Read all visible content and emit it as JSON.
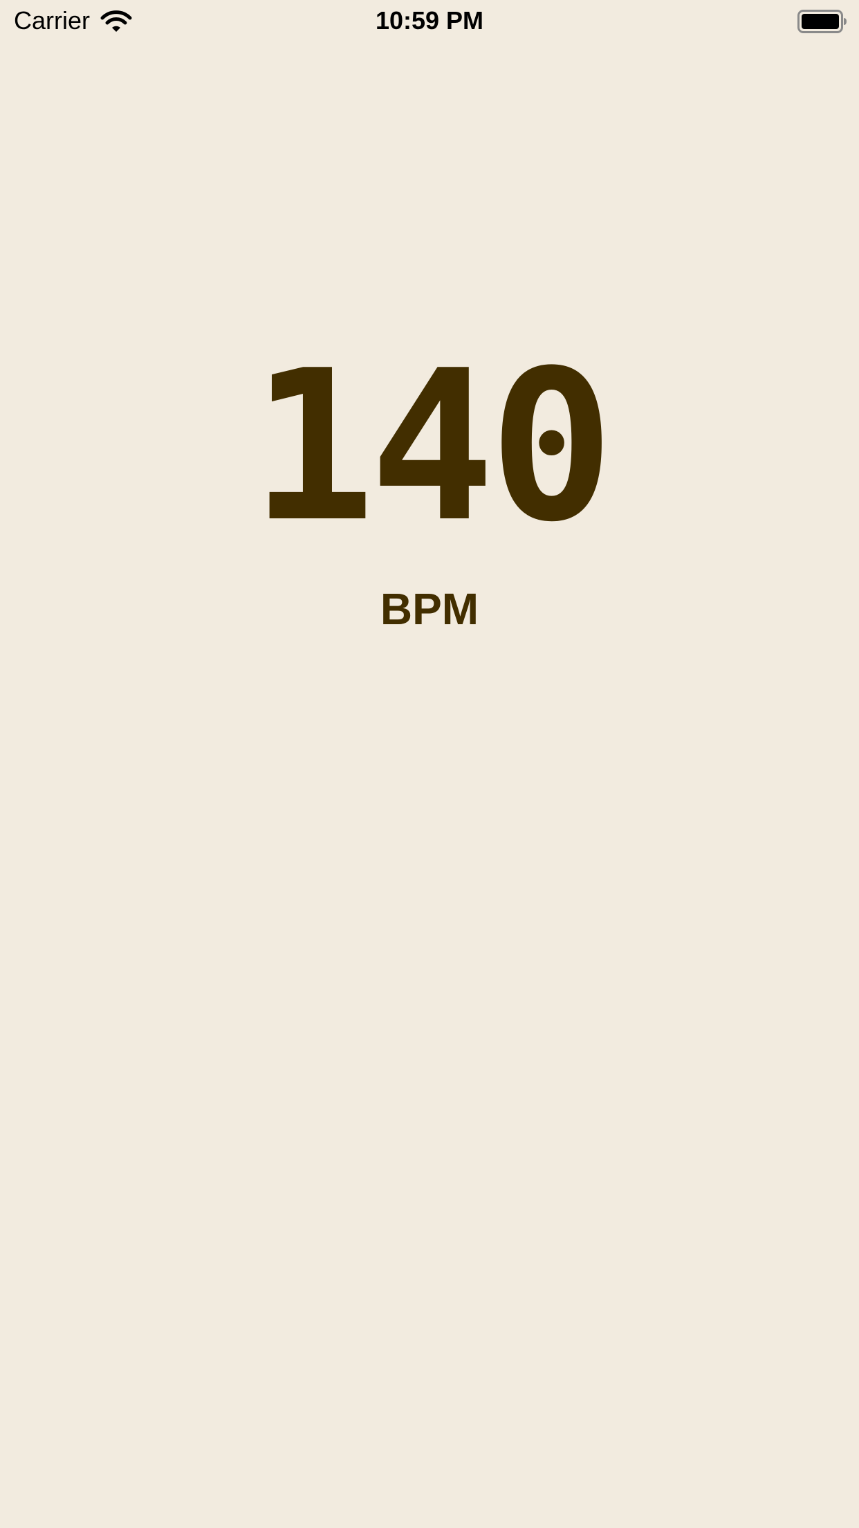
{
  "status_bar": {
    "carrier": "Carrier",
    "time": "10:59 PM",
    "wifi_icon": "wifi-icon",
    "battery_icon": "battery-full-icon"
  },
  "heart_rate": {
    "value": "140",
    "unit": "BPM"
  },
  "colors": {
    "background": "#f2ebdf",
    "text": "#422e00"
  }
}
